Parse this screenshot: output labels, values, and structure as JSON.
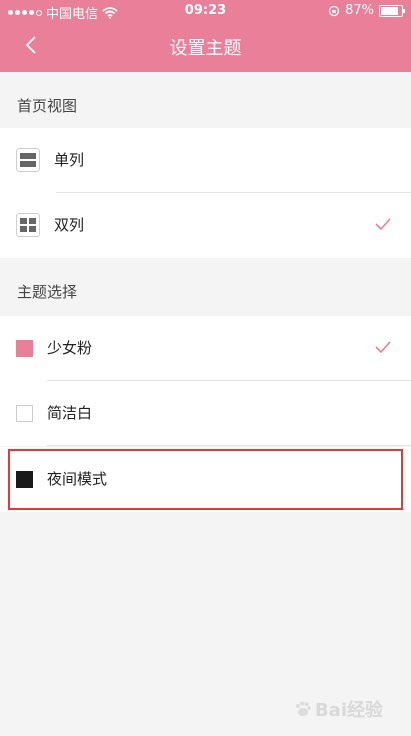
{
  "status_bar": {
    "carrier": "中国电信",
    "time": "09:23",
    "battery": "87%",
    "battery_level": 0.87
  },
  "nav": {
    "title": "设置主题"
  },
  "sections": [
    {
      "header": "首页视图"
    },
    {
      "header": "主题选择"
    }
  ],
  "view_options": [
    {
      "label": "单列",
      "icon": "single-column-icon",
      "selected": false
    },
    {
      "label": "双列",
      "icon": "double-column-icon",
      "selected": true
    }
  ],
  "theme_options": [
    {
      "label": "少女粉",
      "color": "#ea7f9a",
      "selected": true
    },
    {
      "label": "简洁白",
      "color": "#ffffff",
      "selected": false
    },
    {
      "label": "夜间模式",
      "color": "#1a1a1a",
      "selected": false
    }
  ],
  "colors": {
    "accent": "#ea7f9a",
    "highlight": "#e53939"
  },
  "watermark": {
    "text": "Bai经验"
  }
}
